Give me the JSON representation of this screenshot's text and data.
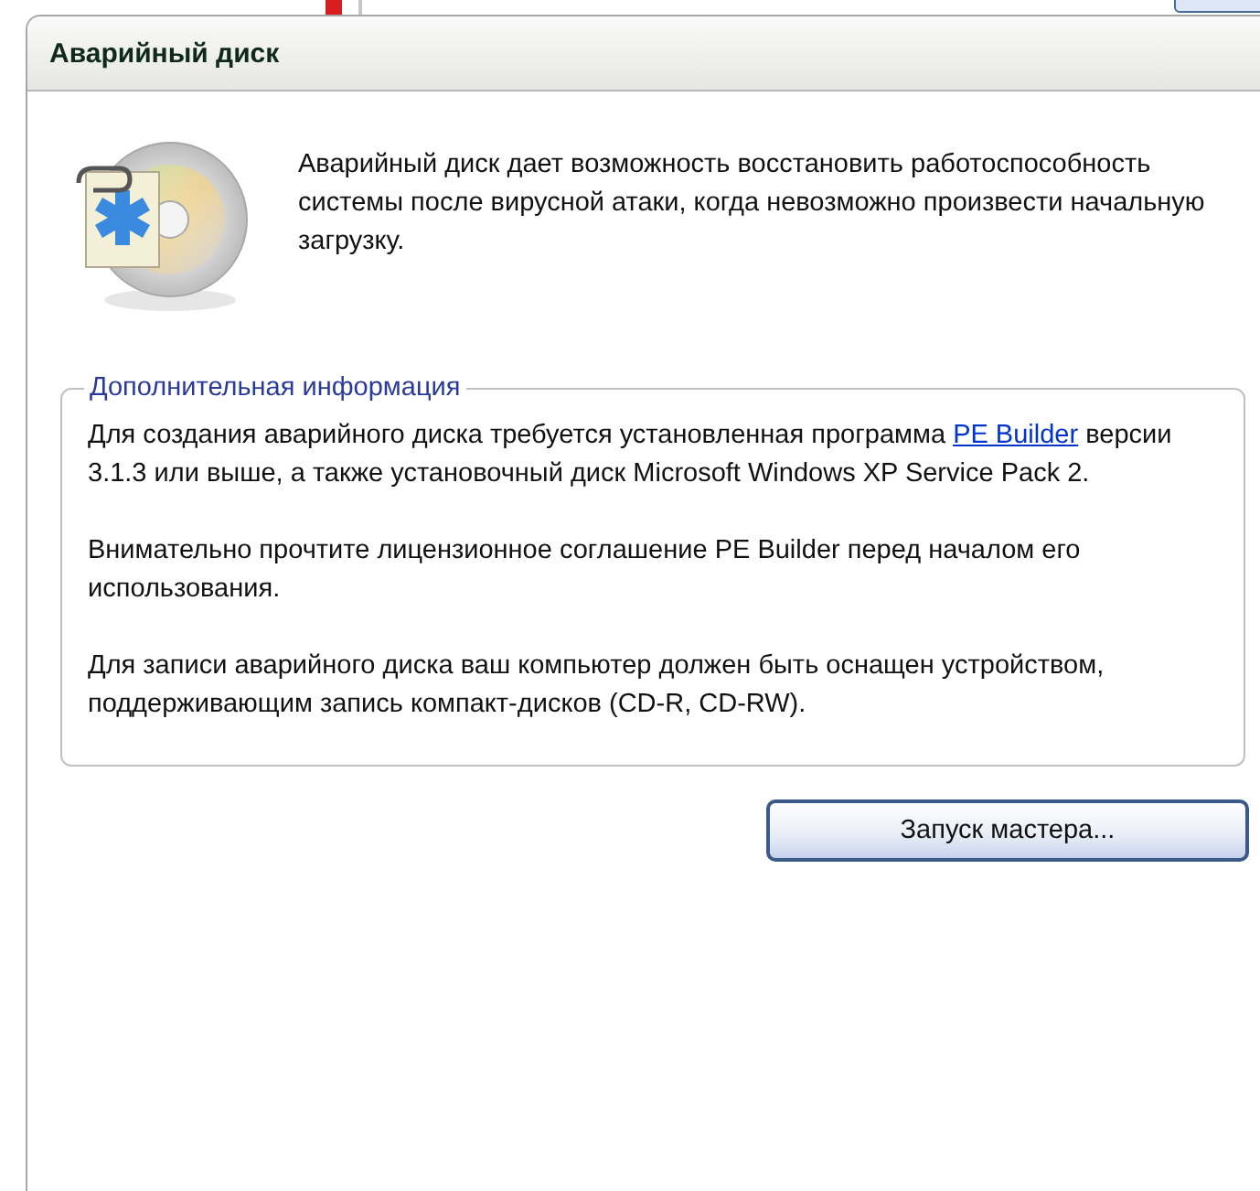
{
  "panel": {
    "title": "Аварийный диск",
    "description": "Аварийный диск дает возможность восстановить работоспособность системы после вирусной атаки, когда невозможно произвести начальную загрузку."
  },
  "info": {
    "legend": "Дополнительная информация",
    "paragraphs": [
      {
        "before": "Для создания аварийного диска требуется установленная программа ",
        "link": "PE Builder",
        "after": " версии 3.1.3 или выше, а также установочный диск Microsoft Windows XP Service Pack 2."
      },
      {
        "before": "Внимательно прочтите лицензионное соглашение PE Builder перед началом его использования."
      },
      {
        "before": "Для записи аварийного диска ваш компьютер должен быть оснащен устройством, поддерживающим запись компакт-дисков (CD-R, CD-RW)."
      }
    ]
  },
  "button": {
    "label": "Запуск мастера..."
  }
}
